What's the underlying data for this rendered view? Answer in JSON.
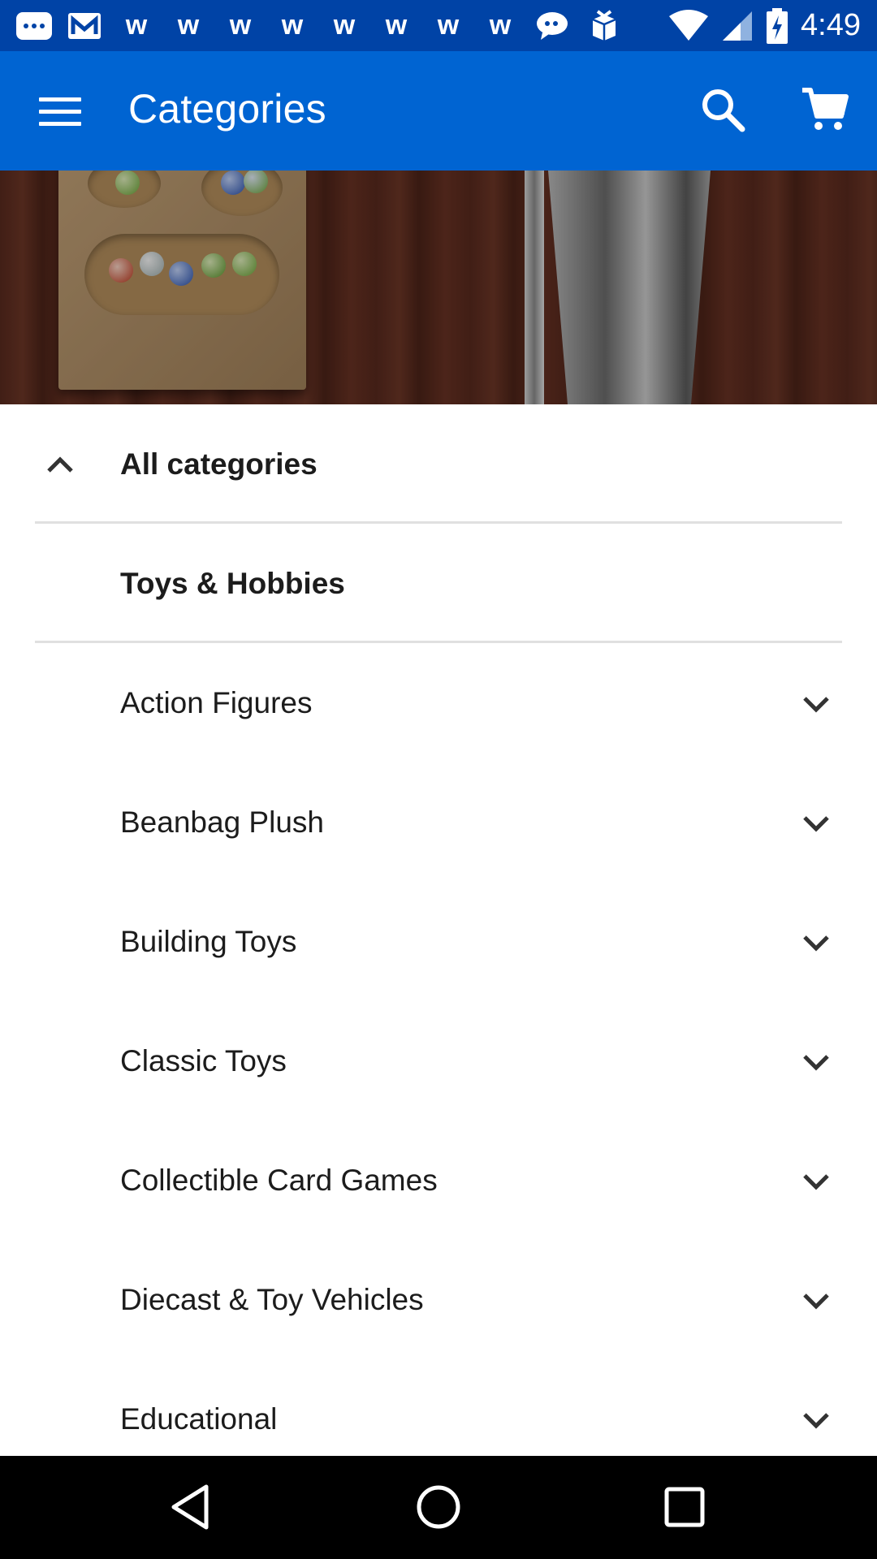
{
  "status_bar": {
    "time": "4:49",
    "notification_icons": [
      "message-icon",
      "gmail-icon",
      "w-app-icon",
      "w-app-icon",
      "w-app-icon",
      "w-app-icon",
      "w-app-icon",
      "w-app-icon",
      "w-app-icon",
      "w-app-icon",
      "chat-icon",
      "box-icon"
    ],
    "w_glyph": "w"
  },
  "app_bar": {
    "title": "Categories",
    "background": "#0064d2"
  },
  "categories": {
    "header": "All categories",
    "selected": "Toys & Hobbies",
    "items": [
      {
        "label": "Action Figures"
      },
      {
        "label": "Beanbag Plush"
      },
      {
        "label": "Building Toys"
      },
      {
        "label": "Classic Toys"
      },
      {
        "label": "Collectible Card Games"
      },
      {
        "label": "Diecast & Toy Vehicles"
      },
      {
        "label": "Educational"
      }
    ]
  }
}
